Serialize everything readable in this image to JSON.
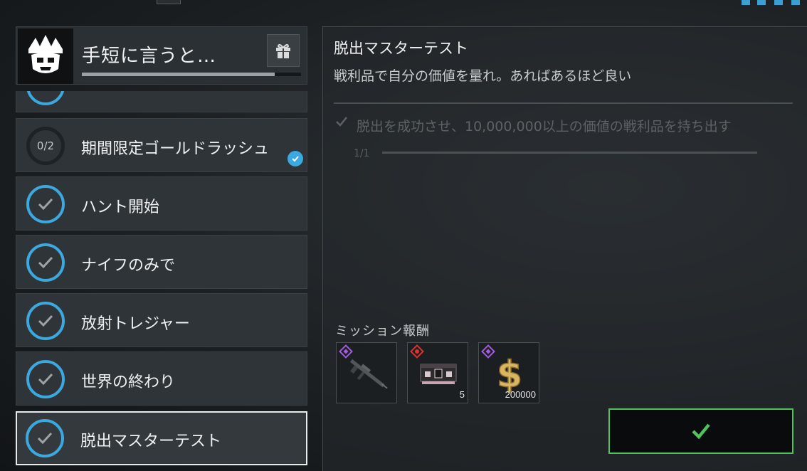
{
  "header": {
    "title": "手短に言うと…",
    "progress": 0.88,
    "logo_icon": "crown-skull-logo",
    "gift_icon": "gift-icon"
  },
  "missions": [
    {
      "label": "",
      "state": "completed",
      "partial": true
    },
    {
      "label": "期間限定ゴールドラッシュ",
      "state": "in-progress",
      "progress_text": "0/2",
      "badge": "check-badge"
    },
    {
      "label": "ハント開始",
      "state": "completed"
    },
    {
      "label": "ナイフのみで",
      "state": "completed"
    },
    {
      "label": "放射トレジャー",
      "state": "completed"
    },
    {
      "label": "世界の終わり",
      "state": "completed"
    },
    {
      "label": "脱出マスターテスト",
      "state": "completed",
      "selected": true
    }
  ],
  "detail": {
    "title": "脱出マスターテスト",
    "description": "戦利品で自分の価値を量れ。あればあるほど良い",
    "objective": {
      "text": "脱出を成功させ、10,000,000以上の価値の戦利品を持ち出す",
      "count": "1/1",
      "completed": true
    },
    "rewards_label": "ミッション報酬",
    "rewards": [
      {
        "icon": "rifle-icon",
        "rarity": "purple",
        "quantity": ""
      },
      {
        "icon": "crate-icon",
        "rarity": "red",
        "quantity": "5"
      },
      {
        "icon": "dollar-icon",
        "rarity": "purple",
        "quantity": "200000"
      }
    ],
    "confirm_icon": "check-icon"
  },
  "colors": {
    "accent": "#3ba9e0",
    "confirm_border": "#4fc25c",
    "rarity_purple": "#a45be0",
    "rarity_red": "#e0322f"
  }
}
